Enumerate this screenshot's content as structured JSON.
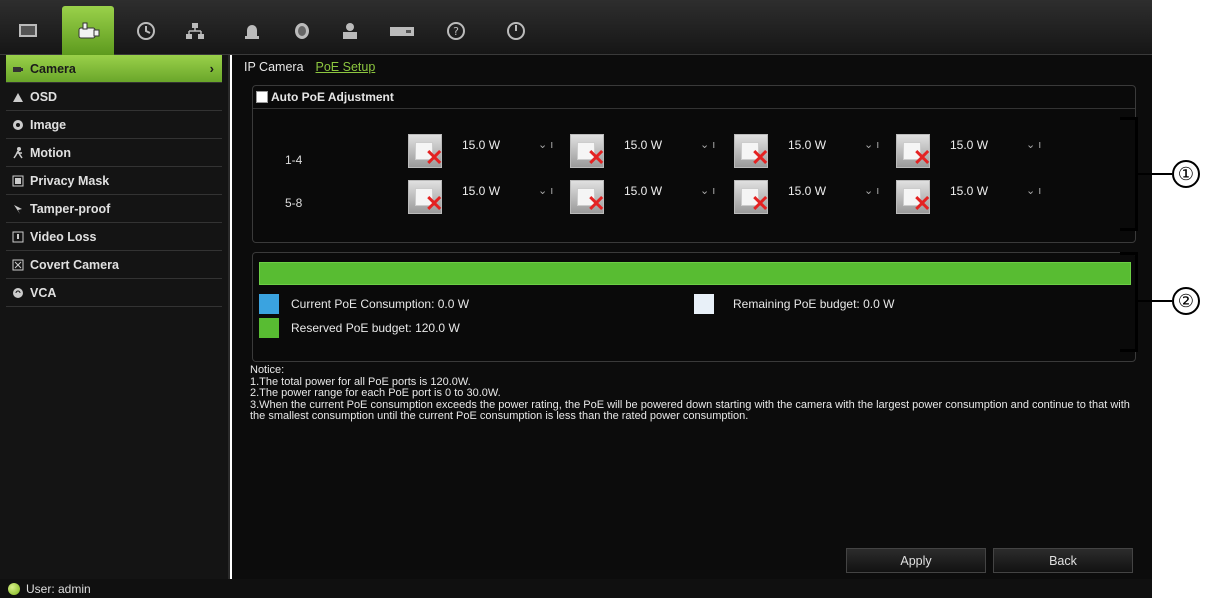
{
  "toolbar": {
    "icons": [
      "monitor-icon",
      "camera-icon",
      "clock-icon",
      "network-icon",
      "alarm-icon",
      "hdd-icon",
      "user-icon",
      "device-icon",
      "help-icon",
      "power-icon"
    ],
    "active_color": "#8cc63f"
  },
  "sidebar": {
    "items": [
      {
        "label": "Camera",
        "icon": "camera-icon"
      },
      {
        "label": "OSD",
        "icon": "osd-icon"
      },
      {
        "label": "Image",
        "icon": "image-icon"
      },
      {
        "label": "Motion",
        "icon": "motion-icon"
      },
      {
        "label": "Privacy Mask",
        "icon": "privacy-mask-icon"
      },
      {
        "label": "Tamper-proof",
        "icon": "tamper-icon"
      },
      {
        "label": "Video Loss",
        "icon": "video-loss-icon"
      },
      {
        "label": "Covert Camera",
        "icon": "covert-icon"
      },
      {
        "label": "VCA",
        "icon": "vca-icon"
      }
    ],
    "active_arrow": "›"
  },
  "tabs": [
    {
      "label": "IP Camera"
    },
    {
      "label": "PoE Setup"
    }
  ],
  "auto_poe": {
    "label": "Auto PoE Adjustment",
    "checked": false
  },
  "ports": {
    "rows": [
      {
        "label": "1-4",
        "watts": [
          "15.0 W",
          "15.0 W",
          "15.0 W",
          "15.0 W"
        ]
      },
      {
        "label": "5-8",
        "watts": [
          "15.0 W",
          "15.0 W",
          "15.0 W",
          "15.0 W"
        ]
      }
    ],
    "status": "disconnected"
  },
  "budget": {
    "current_label": "Current PoE Consumption: 0.0 W",
    "remaining_label": "Remaining PoE budget: 0.0 W",
    "reserved_label": "Reserved PoE budget: 120.0 W",
    "current_color": "#3aa3e0",
    "remaining_color": "#e8f0f8",
    "reserved_color": "#58bc32",
    "reserved_fraction": 1.0
  },
  "notice": {
    "title": "Notice:",
    "lines": [
      "1.The total power for all PoE ports is 120.0W.",
      "2.The power range for each PoE port is 0 to 30.0W.",
      "3.When the current PoE consumption exceeds the power rating, the PoE will be powered down starting with the camera with the largest power consumption and continue to that with the smallest consumption until the current PoE consumption is less than the rated power consumption."
    ]
  },
  "buttons": {
    "apply": "Apply",
    "back": "Back"
  },
  "status": {
    "user": "User: admin"
  },
  "callouts": [
    "①",
    "②"
  ]
}
